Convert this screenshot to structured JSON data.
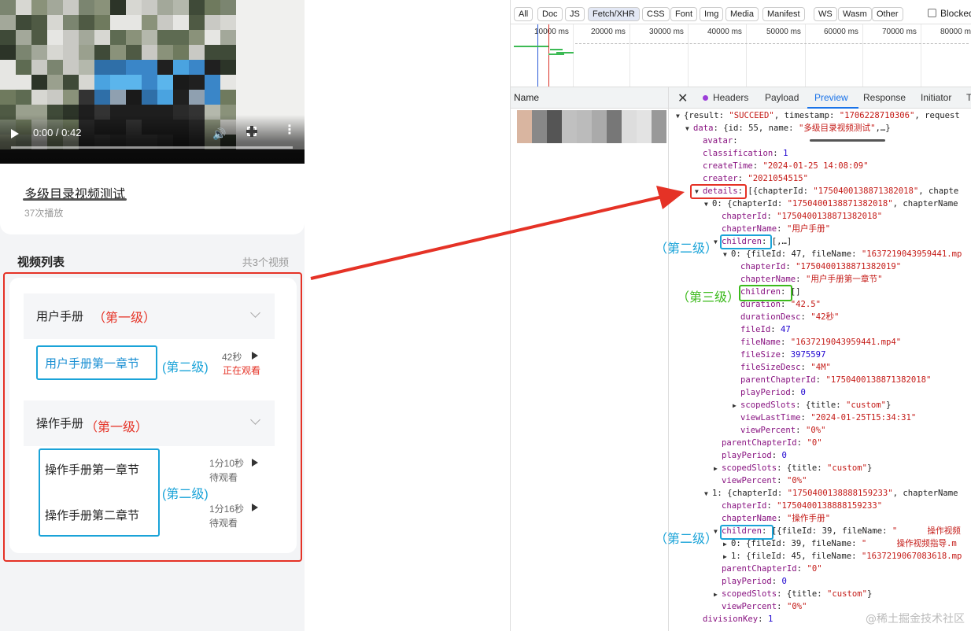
{
  "player": {
    "time": "0:00 / 0:42",
    "volume_icon": "volume-icon",
    "fullscreen_icon": "fullscreen-icon",
    "more_icon": "more-icon",
    "more_glyph": "⋮"
  },
  "video": {
    "title": "多级目录视频测试",
    "play_count": "37次播放"
  },
  "list": {
    "heading": "视频列表",
    "count": "共3个视频"
  },
  "chapters": [
    {
      "name": "用户手册",
      "level_note": "（第一级）",
      "sections": [
        {
          "name": "用户手册第一章节",
          "duration": "42秒",
          "status": "正在观看"
        }
      ]
    },
    {
      "name": "操作手册",
      "level_note": "（第一级）",
      "sections": [
        {
          "name": "操作手册第一章节",
          "duration": "1分10秒",
          "status": "待观看"
        },
        {
          "name": "操作手册第二章节",
          "duration": "1分16秒",
          "status": "待观看"
        }
      ]
    }
  ],
  "annotations": {
    "second_level": "(第二级)",
    "second_level_fullwidth": "（第二级）",
    "third_level_fullwidth": "（第三级）"
  },
  "devtools": {
    "filters": [
      "All",
      "Doc",
      "JS",
      "Fetch/XHR",
      "CSS",
      "Font",
      "Img",
      "Media",
      "Manifest",
      "WS",
      "Wasm",
      "Other"
    ],
    "active_filter": "Fetch/XHR",
    "blocked_label": "Blocked",
    "timeline_labels": [
      "10000 ms",
      "20000 ms",
      "30000 ms",
      "40000 ms",
      "50000 ms",
      "60000 ms",
      "70000 ms",
      "80000 ms"
    ],
    "name_column": "Name",
    "tabs": [
      "Headers",
      "Payload",
      "Preview",
      "Response",
      "Initiator",
      "T"
    ],
    "active_tab": "Preview",
    "colors": {
      "accent": "#1a73e8",
      "key": "#881280",
      "string": "#c41a16",
      "number": "#1c00cf"
    }
  },
  "json_lines": [
    {
      "i": 0,
      "t": "▼",
      "segs": [
        [
          "p",
          "{result: "
        ],
        [
          "s",
          "\"SUCCEED\""
        ],
        [
          "p",
          ", timestamp: "
        ],
        [
          "s",
          "\"1706228710306\""
        ],
        [
          "p",
          ", request"
        ]
      ]
    },
    {
      "i": 1,
      "t": "▼",
      "segs": [
        [
          "k",
          "data"
        ],
        [
          "p",
          ": {id: 55, name: "
        ],
        [
          "s",
          "\"多级目录视频测试\""
        ],
        [
          "p",
          ",…}"
        ]
      ]
    },
    {
      "i": 2,
      "t": "",
      "segs": [
        [
          "k",
          "avatar"
        ],
        [
          "p",
          ": "
        ]
      ]
    },
    {
      "i": 2,
      "t": "",
      "segs": [
        [
          "k",
          "classification"
        ],
        [
          "p",
          ": "
        ],
        [
          "n",
          "1"
        ]
      ]
    },
    {
      "i": 2,
      "t": "",
      "segs": [
        [
          "k",
          "createTime"
        ],
        [
          "p",
          ": "
        ],
        [
          "s",
          "\"2024-01-25 14:08:09\""
        ]
      ]
    },
    {
      "i": 2,
      "t": "",
      "segs": [
        [
          "k",
          "creater"
        ],
        [
          "p",
          ": "
        ],
        [
          "s",
          "\"2021054515\""
        ]
      ]
    },
    {
      "i": 2,
      "t": "▼",
      "segs": [
        [
          "k",
          "details"
        ],
        [
          "p",
          ": [{chapterId: "
        ],
        [
          "s",
          "\"1750400138871382018\""
        ],
        [
          "p",
          ", chapte"
        ]
      ]
    },
    {
      "i": 3,
      "t": "▼",
      "segs": [
        [
          "p",
          "0: {chapterId: "
        ],
        [
          "s",
          "\"1750400138871382018\""
        ],
        [
          "p",
          ", chapterName"
        ]
      ]
    },
    {
      "i": 4,
      "t": "",
      "segs": [
        [
          "k",
          "chapterId"
        ],
        [
          "p",
          ": "
        ],
        [
          "s",
          "\"1750400138871382018\""
        ]
      ]
    },
    {
      "i": 4,
      "t": "",
      "segs": [
        [
          "k",
          "chapterName"
        ],
        [
          "p",
          ": "
        ],
        [
          "s",
          "\"用户手册\""
        ]
      ]
    },
    {
      "i": 4,
      "t": "▼",
      "segs": [
        [
          "k",
          "children"
        ],
        [
          "p",
          ": [,…]"
        ]
      ]
    },
    {
      "i": 5,
      "t": "▼",
      "segs": [
        [
          "p",
          "0: {fileId: 47, fileName: "
        ],
        [
          "s",
          "\"1637219043959441.mp"
        ]
      ]
    },
    {
      "i": 6,
      "t": "",
      "segs": [
        [
          "k",
          "chapterId"
        ],
        [
          "p",
          ": "
        ],
        [
          "s",
          "\"1750400138871382019\""
        ]
      ]
    },
    {
      "i": 6,
      "t": "",
      "segs": [
        [
          "k",
          "chapterName"
        ],
        [
          "p",
          ": "
        ],
        [
          "s",
          "\"用户手册第一章节\""
        ]
      ]
    },
    {
      "i": 6,
      "t": "",
      "segs": [
        [
          "k",
          "children"
        ],
        [
          "p",
          ": []"
        ]
      ]
    },
    {
      "i": 6,
      "t": "",
      "segs": [
        [
          "k",
          "duration"
        ],
        [
          "p",
          ": "
        ],
        [
          "s",
          "\"42.5\""
        ]
      ]
    },
    {
      "i": 6,
      "t": "",
      "segs": [
        [
          "k",
          "durationDesc"
        ],
        [
          "p",
          ": "
        ],
        [
          "s",
          "\"42秒\""
        ]
      ]
    },
    {
      "i": 6,
      "t": "",
      "segs": [
        [
          "k",
          "fileId"
        ],
        [
          "p",
          ": "
        ],
        [
          "n",
          "47"
        ]
      ]
    },
    {
      "i": 6,
      "t": "",
      "segs": [
        [
          "k",
          "fileName"
        ],
        [
          "p",
          ": "
        ],
        [
          "s",
          "\"1637219043959441.mp4\""
        ]
      ]
    },
    {
      "i": 6,
      "t": "",
      "segs": [
        [
          "k",
          "fileSize"
        ],
        [
          "p",
          ": "
        ],
        [
          "n",
          "3975597"
        ]
      ]
    },
    {
      "i": 6,
      "t": "",
      "segs": [
        [
          "k",
          "fileSizeDesc"
        ],
        [
          "p",
          ": "
        ],
        [
          "s",
          "\"4M\""
        ]
      ]
    },
    {
      "i": 6,
      "t": "",
      "segs": [
        [
          "k",
          "parentChapterId"
        ],
        [
          "p",
          ": "
        ],
        [
          "s",
          "\"1750400138871382018\""
        ]
      ]
    },
    {
      "i": 6,
      "t": "",
      "segs": [
        [
          "k",
          "playPeriod"
        ],
        [
          "p",
          ": "
        ],
        [
          "n",
          "0"
        ]
      ]
    },
    {
      "i": 6,
      "t": "▶",
      "segs": [
        [
          "k",
          "scopedSlots"
        ],
        [
          "p",
          ": {title: "
        ],
        [
          "s",
          "\"custom\""
        ],
        [
          "p",
          "}"
        ]
      ]
    },
    {
      "i": 6,
      "t": "",
      "segs": [
        [
          "k",
          "viewLastTime"
        ],
        [
          "p",
          ": "
        ],
        [
          "s",
          "\"2024-01-25T15:34:31\""
        ]
      ]
    },
    {
      "i": 6,
      "t": "",
      "segs": [
        [
          "k",
          "viewPercent"
        ],
        [
          "p",
          ": "
        ],
        [
          "s",
          "\"0%\""
        ]
      ]
    },
    {
      "i": 4,
      "t": "",
      "segs": [
        [
          "k",
          "parentChapterId"
        ],
        [
          "p",
          ": "
        ],
        [
          "s",
          "\"0\""
        ]
      ]
    },
    {
      "i": 4,
      "t": "",
      "segs": [
        [
          "k",
          "playPeriod"
        ],
        [
          "p",
          ": "
        ],
        [
          "n",
          "0"
        ]
      ]
    },
    {
      "i": 4,
      "t": "▶",
      "segs": [
        [
          "k",
          "scopedSlots"
        ],
        [
          "p",
          ": {title: "
        ],
        [
          "s",
          "\"custom\""
        ],
        [
          "p",
          "}"
        ]
      ]
    },
    {
      "i": 4,
      "t": "",
      "segs": [
        [
          "k",
          "viewPercent"
        ],
        [
          "p",
          ": "
        ],
        [
          "s",
          "\"0%\""
        ]
      ]
    },
    {
      "i": 3,
      "t": "▼",
      "segs": [
        [
          "p",
          "1: {chapterId: "
        ],
        [
          "s",
          "\"1750400138888159233\""
        ],
        [
          "p",
          ", chapterName"
        ]
      ]
    },
    {
      "i": 4,
      "t": "",
      "segs": [
        [
          "k",
          "chapterId"
        ],
        [
          "p",
          ": "
        ],
        [
          "s",
          "\"1750400138888159233\""
        ]
      ]
    },
    {
      "i": 4,
      "t": "",
      "segs": [
        [
          "k",
          "chapterName"
        ],
        [
          "p",
          ": "
        ],
        [
          "s",
          "\"操作手册\""
        ]
      ]
    },
    {
      "i": 4,
      "t": "▼",
      "segs": [
        [
          "k",
          "children"
        ],
        [
          "p",
          ": [{fileId: 39, fileName: "
        ],
        [
          "s",
          "\"      操作视频"
        ]
      ]
    },
    {
      "i": 5,
      "t": "▶",
      "segs": [
        [
          "p",
          "0: {fileId: 39, fileName: "
        ],
        [
          "s",
          "\"      操作视频指导.m"
        ]
      ]
    },
    {
      "i": 5,
      "t": "▶",
      "segs": [
        [
          "p",
          "1: {fileId: 45, fileName: "
        ],
        [
          "s",
          "\"1637219067083618.mp"
        ]
      ]
    },
    {
      "i": 4,
      "t": "",
      "segs": [
        [
          "k",
          "parentChapterId"
        ],
        [
          "p",
          ": "
        ],
        [
          "s",
          "\"0\""
        ]
      ]
    },
    {
      "i": 4,
      "t": "",
      "segs": [
        [
          "k",
          "playPeriod"
        ],
        [
          "p",
          ": "
        ],
        [
          "n",
          "0"
        ]
      ]
    },
    {
      "i": 4,
      "t": "▶",
      "segs": [
        [
          "k",
          "scopedSlots"
        ],
        [
          "p",
          ": {title: "
        ],
        [
          "s",
          "\"custom\""
        ],
        [
          "p",
          "}"
        ]
      ]
    },
    {
      "i": 4,
      "t": "",
      "segs": [
        [
          "k",
          "viewPercent"
        ],
        [
          "p",
          ": "
        ],
        [
          "s",
          "\"0%\""
        ]
      ]
    },
    {
      "i": 2,
      "t": "",
      "segs": [
        [
          "k",
          "divisionKey"
        ],
        [
          "p",
          ": "
        ],
        [
          "n",
          "1"
        ]
      ]
    }
  ],
  "watermark": "@稀土掘金技术社区"
}
